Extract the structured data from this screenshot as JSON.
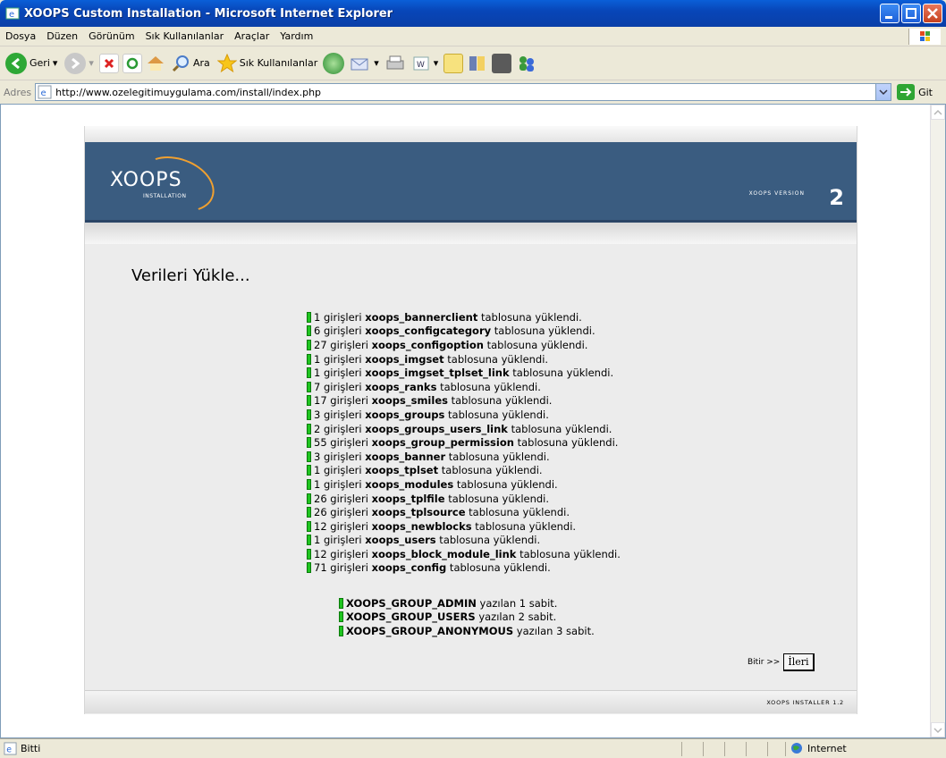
{
  "window": {
    "title": "XOOPS Custom Installation - Microsoft Internet Explorer"
  },
  "menu": [
    "Dosya",
    "Düzen",
    "Görünüm",
    "Sık Kullanılanlar",
    "Araçlar",
    "Yardım"
  ],
  "toolbar": {
    "back_label": "Geri",
    "search_label": "Ara",
    "favorites_label": "Sık Kullanılanlar"
  },
  "address": {
    "label": "Adres",
    "url": "http://www.ozelegitimuygulama.com/install/index.php",
    "go_label": "Git"
  },
  "banner": {
    "logo": "XOOPS",
    "logo_sub": "INSTALLATION",
    "version_label": "XOOPS VERSION",
    "version_number": "2"
  },
  "page": {
    "heading": "Verileri Yükle...",
    "log": [
      {
        "count": "1",
        "table": "xoops_bannerclient"
      },
      {
        "count": "6",
        "table": "xoops_configcategory"
      },
      {
        "count": "27",
        "table": "xoops_configoption"
      },
      {
        "count": "1",
        "table": "xoops_imgset"
      },
      {
        "count": "1",
        "table": "xoops_imgset_tplset_link"
      },
      {
        "count": "7",
        "table": "xoops_ranks"
      },
      {
        "count": "17",
        "table": "xoops_smiles"
      },
      {
        "count": "3",
        "table": "xoops_groups"
      },
      {
        "count": "2",
        "table": "xoops_groups_users_link"
      },
      {
        "count": "55",
        "table": "xoops_group_permission"
      },
      {
        "count": "3",
        "table": "xoops_banner"
      },
      {
        "count": "1",
        "table": "xoops_tplset"
      },
      {
        "count": "1",
        "table": "xoops_modules"
      },
      {
        "count": "26",
        "table": "xoops_tplfile"
      },
      {
        "count": "26",
        "table": "xoops_tplsource"
      },
      {
        "count": "12",
        "table": "xoops_newblocks"
      },
      {
        "count": "1",
        "table": "xoops_users"
      },
      {
        "count": "12",
        "table": "xoops_block_module_link"
      },
      {
        "count": "71",
        "table": "xoops_config"
      }
    ],
    "log_prefix": " girişleri ",
    "log_suffix": " tablosuna yüklendi.",
    "constants": [
      {
        "name": "XOOPS_GROUP_ADMIN",
        "rest": " yazılan 1 sabit."
      },
      {
        "name": "XOOPS_GROUP_USERS",
        "rest": " yazılan 2 sabit."
      },
      {
        "name": "XOOPS_GROUP_ANONYMOUS",
        "rest": " yazılan 3 sabit."
      }
    ],
    "finish_label": "Bitir >>",
    "next_label": "İleri",
    "footer": "XOOPS INSTALLER 1.2"
  },
  "status": {
    "text": "Bitti",
    "zone": "Internet"
  },
  "colors": {
    "banner": "#3a5c80",
    "bullet": "#1fc520",
    "titlebar": "#0a5fd8"
  }
}
